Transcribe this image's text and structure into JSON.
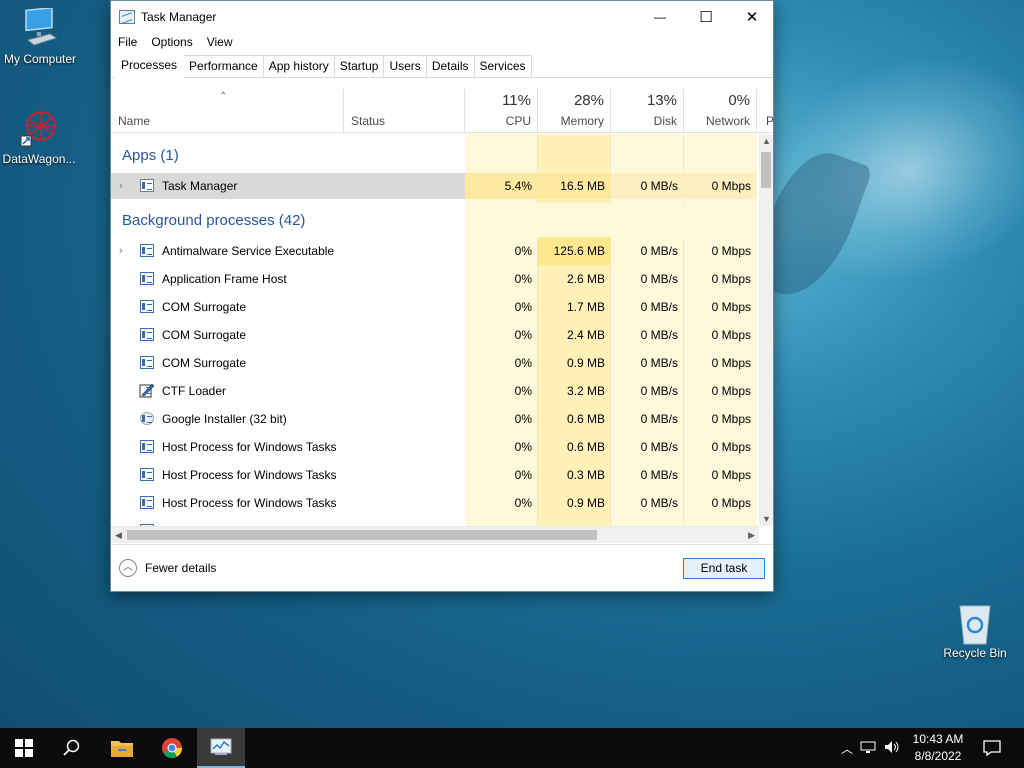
{
  "desktop": {
    "icons": [
      {
        "label": "My Computer",
        "icon": "computer-icon"
      },
      {
        "label": "DataWagon...",
        "icon": "datawagon-icon"
      },
      {
        "label": "Recycle Bin",
        "icon": "recycle-bin-icon"
      }
    ]
  },
  "window": {
    "title": "Task Manager",
    "controls": {
      "minimize": "—",
      "maximize": "☐",
      "close": "✕"
    },
    "menu": [
      "File",
      "Options",
      "View"
    ],
    "tabs": [
      "Processes",
      "Performance",
      "App history",
      "Startup",
      "Users",
      "Details",
      "Services"
    ],
    "active_tab": "Processes"
  },
  "columns": {
    "name": "Name",
    "status": "Status",
    "cpu": {
      "pct": "11%",
      "label": "CPU"
    },
    "memory": {
      "pct": "28%",
      "label": "Memory"
    },
    "disk": {
      "pct": "13%",
      "label": "Disk"
    },
    "network": {
      "pct": "0%",
      "label": "Network"
    },
    "power_partial": "P"
  },
  "groups": {
    "apps": "Apps (1)",
    "background": "Background processes (42)"
  },
  "apps": [
    {
      "name": "Task Manager",
      "cpu": "5.4%",
      "memory": "16.5 MB",
      "disk": "0 MB/s",
      "network": "0 Mbps"
    }
  ],
  "background": [
    {
      "name": "Antimalware Service Executable",
      "cpu": "0%",
      "memory": "125.6 MB",
      "disk": "0 MB/s",
      "network": "0 Mbps",
      "expandable": true
    },
    {
      "name": "Application Frame Host",
      "cpu": "0%",
      "memory": "2.6 MB",
      "disk": "0 MB/s",
      "network": "0 Mbps"
    },
    {
      "name": "COM Surrogate",
      "cpu": "0%",
      "memory": "1.7 MB",
      "disk": "0 MB/s",
      "network": "0 Mbps"
    },
    {
      "name": "COM Surrogate",
      "cpu": "0%",
      "memory": "2.4 MB",
      "disk": "0 MB/s",
      "network": "0 Mbps"
    },
    {
      "name": "COM Surrogate",
      "cpu": "0%",
      "memory": "0.9 MB",
      "disk": "0 MB/s",
      "network": "0 Mbps"
    },
    {
      "name": "CTF Loader",
      "cpu": "0%",
      "memory": "3.2 MB",
      "disk": "0 MB/s",
      "network": "0 Mbps"
    },
    {
      "name": "Google Installer (32 bit)",
      "cpu": "0%",
      "memory": "0.6 MB",
      "disk": "0 MB/s",
      "network": "0 Mbps"
    },
    {
      "name": "Host Process for Windows Tasks",
      "cpu": "0%",
      "memory": "0.6 MB",
      "disk": "0 MB/s",
      "network": "0 Mbps"
    },
    {
      "name": "Host Process for Windows Tasks",
      "cpu": "0%",
      "memory": "0.3 MB",
      "disk": "0 MB/s",
      "network": "0 Mbps"
    },
    {
      "name": "Host Process for Windows Tasks",
      "cpu": "0%",
      "memory": "0.9 MB",
      "disk": "0 MB/s",
      "network": "0 Mbps"
    }
  ],
  "footer": {
    "fewer_details": "Fewer details",
    "end_task": "End task"
  },
  "taskbar": {
    "time": "10:43 AM",
    "date": "8/8/2022"
  },
  "colors": {
    "heat_light": "#fff9dc",
    "heat_medium": "#fff1b8",
    "heat_strong": "#ffe88e",
    "selected_row": "#d9d9d9",
    "group_text": "#2b5797"
  }
}
